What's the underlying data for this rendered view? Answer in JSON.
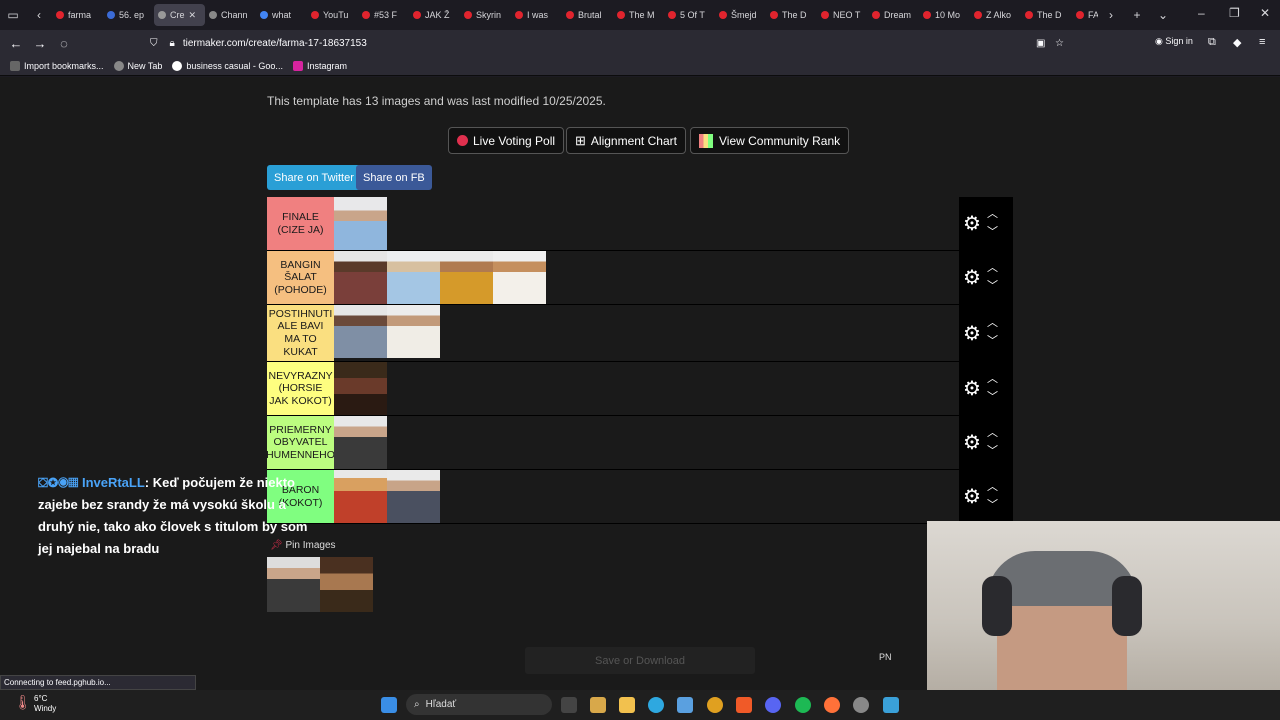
{
  "browser": {
    "tabs": [
      "farma",
      "56. ep",
      "Cre",
      "Chann",
      "what",
      "YouTu",
      "#53 F",
      "JAK Ž",
      "Skyrin",
      "I was",
      "Brutal",
      "The M",
      "5 Of T",
      "Šmejd",
      "The D",
      "NEO T",
      "Dream",
      "10 Mo",
      "Z Alko",
      "The D",
      "FA"
    ],
    "url": "tiermaker.com/create/farma-17-18637153",
    "sign_in": "Sign in",
    "bookmarks": [
      "Import bookmarks...",
      "New Tab",
      "business casual - Goo...",
      "Instagram"
    ],
    "status_text": "Connecting to feed.pghub.io..."
  },
  "page": {
    "info_text": "This template has 13 images and was last modified 10/25/2025.",
    "live_voting": "Live Voting Poll",
    "alignment_chart": "Alignment Chart",
    "community_rank": "View Community Rank",
    "share_twitter": "Share on Twitter",
    "share_fb": "Share on FB",
    "pin_images": "Pin Images",
    "save_download": "Save or Download",
    "pn": "PN",
    "tiers": [
      {
        "label": "FINALE (CIZE JA)",
        "color": "#f08080"
      },
      {
        "label": "BANGIN ŠALAT (POHODE)",
        "color": "#f5bf80"
      },
      {
        "label": "POSTIHNUTI ALE BAVI MA TO KUKAT",
        "color": "#fadf80"
      },
      {
        "label": "NEVYRAZNY (HORSIE JAK KOKOT)",
        "color": "#fefe80"
      },
      {
        "label": "PRIEMERNY OBYVATEL HUMENNEHO",
        "color": "#bcfd80"
      },
      {
        "label": "BARON (KOKOT)",
        "color": "#80fe80"
      }
    ]
  },
  "chat": {
    "user": "InveRtaLL",
    "message": ": Keď počujem že niekto zajebe bez srandy že má vysokú školu a druhý nie, tako ako človek s titulom by som jej najebal na bradu"
  },
  "taskbar": {
    "temperature": "6°C",
    "weather": "Windy",
    "search": "Hľadať"
  }
}
